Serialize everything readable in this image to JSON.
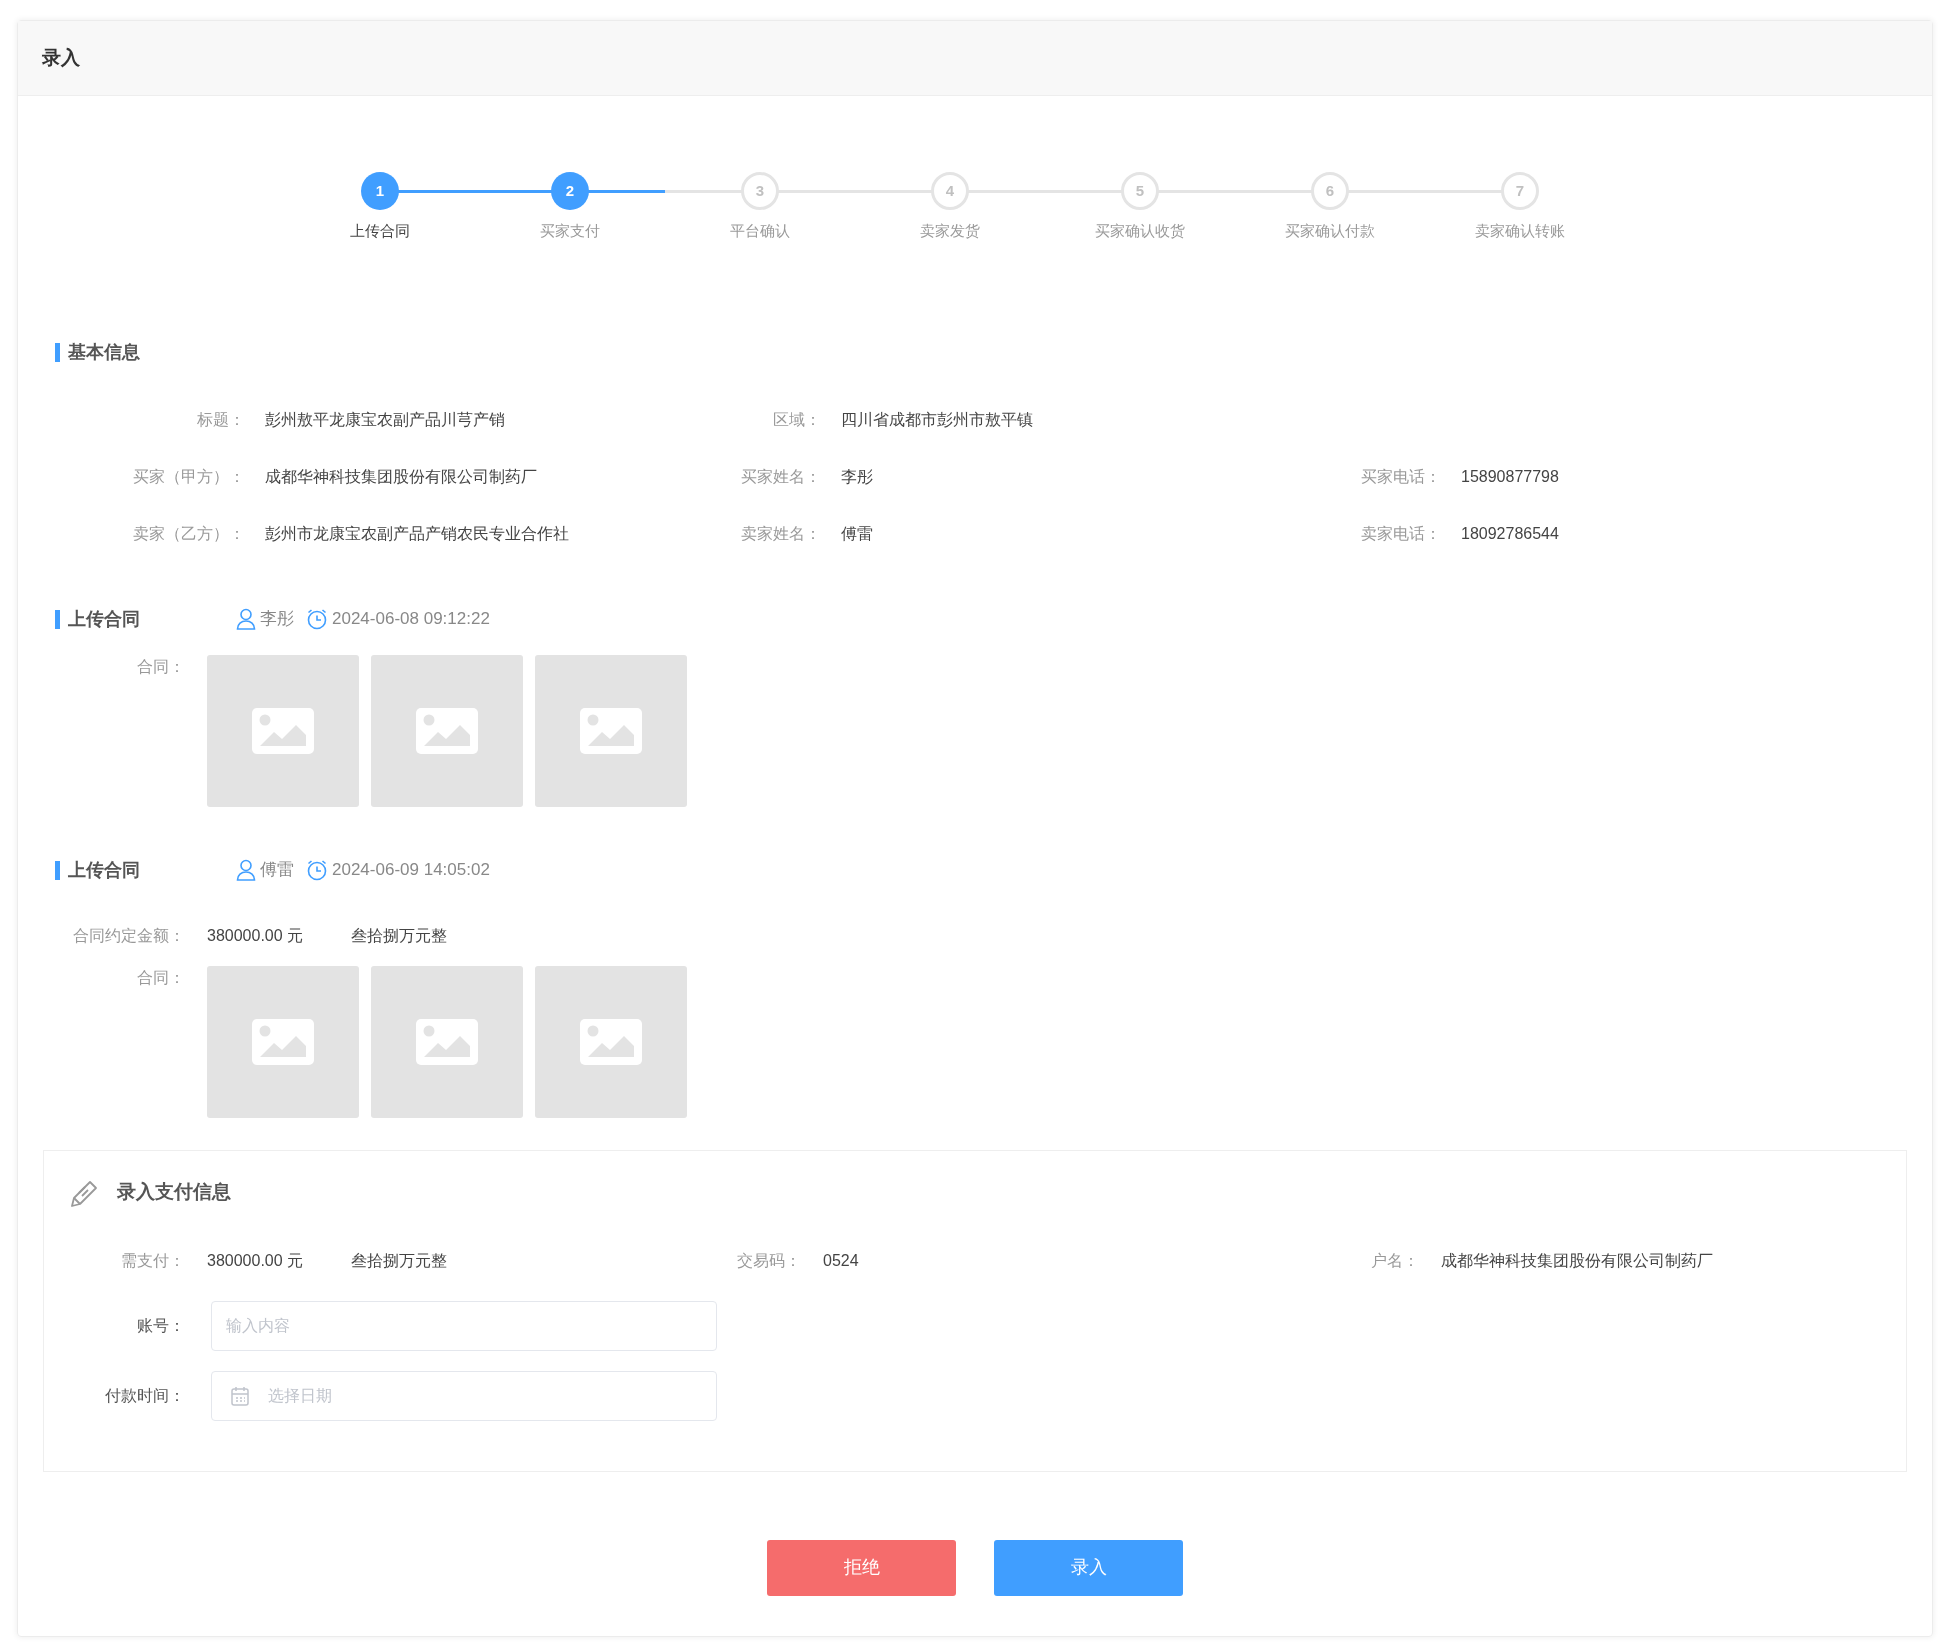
{
  "page": {
    "title": "录入"
  },
  "steps": [
    {
      "number": "1",
      "label": "上传合同",
      "reached": true,
      "level": 1,
      "selected": true
    },
    {
      "number": "2",
      "label": "买家支付",
      "reached": true,
      "level": 0.5,
      "selected": false
    },
    {
      "number": "3",
      "label": "平台确认",
      "reached": false,
      "selected": false
    },
    {
      "number": "4",
      "label": "卖家发货",
      "reached": false,
      "selected": false
    },
    {
      "number": "5",
      "label": "买家确认收货",
      "reached": false,
      "selected": false
    },
    {
      "number": "6",
      "label": "买家确认付款",
      "reached": false,
      "selected": false
    },
    {
      "number": "7",
      "label": "卖家确认转账",
      "reached": false,
      "selected": false
    }
  ],
  "basic_info": {
    "title": "基本信息",
    "rows": [
      [
        {
          "label": "标题：",
          "value": "彭州敖平龙康宝农副产品川芎产销"
        },
        {
          "label": "区域：",
          "value": "四川省成都市彭州市敖平镇"
        }
      ],
      [
        {
          "label": "买家（甲方）：",
          "value": "成都华神科技集团股份有限公司制药厂"
        },
        {
          "label": "买家姓名：",
          "value": "李彤"
        },
        {
          "label": "买家电话：",
          "value": "15890877798"
        }
      ],
      [
        {
          "label": "卖家（乙方）：",
          "value": "彭州市龙康宝农副产品产销农民专业合作社"
        },
        {
          "label": "卖家姓名：",
          "value": "傅雷"
        },
        {
          "label": "卖家电话：",
          "value": "18092786544"
        }
      ]
    ]
  },
  "uploads": [
    {
      "title": "上传合同",
      "user": "李彤",
      "time": "2024-06-08 09:12:22",
      "fields": [
        {
          "kind": "images",
          "label": "合同：",
          "images": [
            {
              "kind": "image"
            },
            {
              "kind": "image"
            },
            {
              "kind": "image"
            }
          ]
        }
      ]
    },
    {
      "title": "上传合同",
      "user": "傅雷",
      "time": "2024-06-09 14:05:02",
      "fields": [
        {
          "kind": "amount",
          "label": "合同约定金额：",
          "value": "380000.00 元",
          "words": "叁拾捌万元整"
        },
        {
          "kind": "images",
          "label": "合同：",
          "images": [
            {
              "kind": "image"
            },
            {
              "kind": "image"
            },
            {
              "kind": "image"
            }
          ]
        }
      ]
    }
  ],
  "payment": {
    "title": "录入支付信息",
    "due": {
      "label": "需支付：",
      "value": "380000.00 元",
      "words": "叁拾捌万元整"
    },
    "code": {
      "label": "交易码：",
      "value": "0524"
    },
    "account_name": {
      "label": "户名：",
      "value": "成都华神科技集团股份有限公司制药厂"
    },
    "inputs": [
      {
        "kind": "text",
        "label": "账号：",
        "placeholder": "输入内容"
      },
      {
        "kind": "date",
        "label": "付款时间：",
        "placeholder": "选择日期"
      }
    ]
  },
  "buttons": [
    {
      "label": "拒绝",
      "kind": "danger"
    },
    {
      "label": "录入",
      "kind": "primary"
    }
  ]
}
